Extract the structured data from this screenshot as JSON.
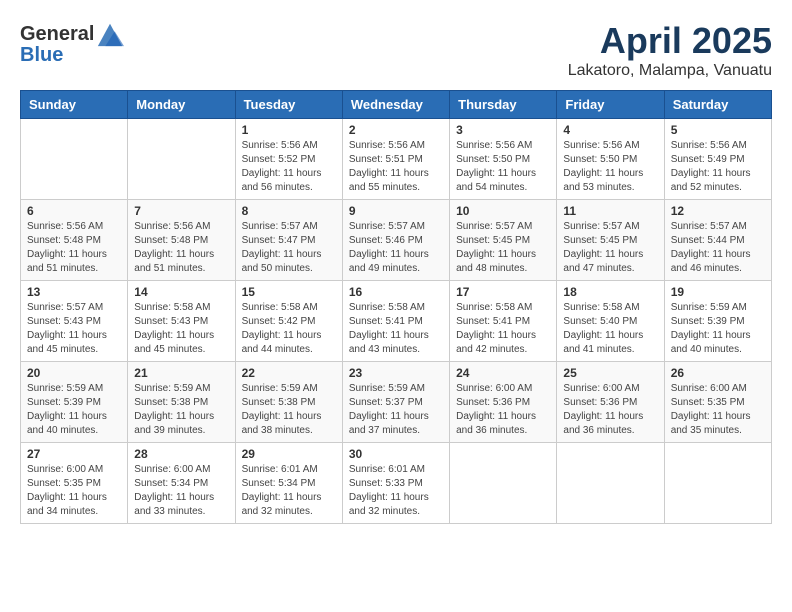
{
  "header": {
    "logo_general": "General",
    "logo_blue": "Blue",
    "month": "April 2025",
    "location": "Lakatoro, Malampa, Vanuatu"
  },
  "weekdays": [
    "Sunday",
    "Monday",
    "Tuesday",
    "Wednesday",
    "Thursday",
    "Friday",
    "Saturday"
  ],
  "weeks": [
    [
      {
        "day": "",
        "sunrise": "",
        "sunset": "",
        "daylight": ""
      },
      {
        "day": "",
        "sunrise": "",
        "sunset": "",
        "daylight": ""
      },
      {
        "day": "1",
        "sunrise": "Sunrise: 5:56 AM",
        "sunset": "Sunset: 5:52 PM",
        "daylight": "Daylight: 11 hours and 56 minutes."
      },
      {
        "day": "2",
        "sunrise": "Sunrise: 5:56 AM",
        "sunset": "Sunset: 5:51 PM",
        "daylight": "Daylight: 11 hours and 55 minutes."
      },
      {
        "day": "3",
        "sunrise": "Sunrise: 5:56 AM",
        "sunset": "Sunset: 5:50 PM",
        "daylight": "Daylight: 11 hours and 54 minutes."
      },
      {
        "day": "4",
        "sunrise": "Sunrise: 5:56 AM",
        "sunset": "Sunset: 5:50 PM",
        "daylight": "Daylight: 11 hours and 53 minutes."
      },
      {
        "day": "5",
        "sunrise": "Sunrise: 5:56 AM",
        "sunset": "Sunset: 5:49 PM",
        "daylight": "Daylight: 11 hours and 52 minutes."
      }
    ],
    [
      {
        "day": "6",
        "sunrise": "Sunrise: 5:56 AM",
        "sunset": "Sunset: 5:48 PM",
        "daylight": "Daylight: 11 hours and 51 minutes."
      },
      {
        "day": "7",
        "sunrise": "Sunrise: 5:56 AM",
        "sunset": "Sunset: 5:48 PM",
        "daylight": "Daylight: 11 hours and 51 minutes."
      },
      {
        "day": "8",
        "sunrise": "Sunrise: 5:57 AM",
        "sunset": "Sunset: 5:47 PM",
        "daylight": "Daylight: 11 hours and 50 minutes."
      },
      {
        "day": "9",
        "sunrise": "Sunrise: 5:57 AM",
        "sunset": "Sunset: 5:46 PM",
        "daylight": "Daylight: 11 hours and 49 minutes."
      },
      {
        "day": "10",
        "sunrise": "Sunrise: 5:57 AM",
        "sunset": "Sunset: 5:45 PM",
        "daylight": "Daylight: 11 hours and 48 minutes."
      },
      {
        "day": "11",
        "sunrise": "Sunrise: 5:57 AM",
        "sunset": "Sunset: 5:45 PM",
        "daylight": "Daylight: 11 hours and 47 minutes."
      },
      {
        "day": "12",
        "sunrise": "Sunrise: 5:57 AM",
        "sunset": "Sunset: 5:44 PM",
        "daylight": "Daylight: 11 hours and 46 minutes."
      }
    ],
    [
      {
        "day": "13",
        "sunrise": "Sunrise: 5:57 AM",
        "sunset": "Sunset: 5:43 PM",
        "daylight": "Daylight: 11 hours and 45 minutes."
      },
      {
        "day": "14",
        "sunrise": "Sunrise: 5:58 AM",
        "sunset": "Sunset: 5:43 PM",
        "daylight": "Daylight: 11 hours and 45 minutes."
      },
      {
        "day": "15",
        "sunrise": "Sunrise: 5:58 AM",
        "sunset": "Sunset: 5:42 PM",
        "daylight": "Daylight: 11 hours and 44 minutes."
      },
      {
        "day": "16",
        "sunrise": "Sunrise: 5:58 AM",
        "sunset": "Sunset: 5:41 PM",
        "daylight": "Daylight: 11 hours and 43 minutes."
      },
      {
        "day": "17",
        "sunrise": "Sunrise: 5:58 AM",
        "sunset": "Sunset: 5:41 PM",
        "daylight": "Daylight: 11 hours and 42 minutes."
      },
      {
        "day": "18",
        "sunrise": "Sunrise: 5:58 AM",
        "sunset": "Sunset: 5:40 PM",
        "daylight": "Daylight: 11 hours and 41 minutes."
      },
      {
        "day": "19",
        "sunrise": "Sunrise: 5:59 AM",
        "sunset": "Sunset: 5:39 PM",
        "daylight": "Daylight: 11 hours and 40 minutes."
      }
    ],
    [
      {
        "day": "20",
        "sunrise": "Sunrise: 5:59 AM",
        "sunset": "Sunset: 5:39 PM",
        "daylight": "Daylight: 11 hours and 40 minutes."
      },
      {
        "day": "21",
        "sunrise": "Sunrise: 5:59 AM",
        "sunset": "Sunset: 5:38 PM",
        "daylight": "Daylight: 11 hours and 39 minutes."
      },
      {
        "day": "22",
        "sunrise": "Sunrise: 5:59 AM",
        "sunset": "Sunset: 5:38 PM",
        "daylight": "Daylight: 11 hours and 38 minutes."
      },
      {
        "day": "23",
        "sunrise": "Sunrise: 5:59 AM",
        "sunset": "Sunset: 5:37 PM",
        "daylight": "Daylight: 11 hours and 37 minutes."
      },
      {
        "day": "24",
        "sunrise": "Sunrise: 6:00 AM",
        "sunset": "Sunset: 5:36 PM",
        "daylight": "Daylight: 11 hours and 36 minutes."
      },
      {
        "day": "25",
        "sunrise": "Sunrise: 6:00 AM",
        "sunset": "Sunset: 5:36 PM",
        "daylight": "Daylight: 11 hours and 36 minutes."
      },
      {
        "day": "26",
        "sunrise": "Sunrise: 6:00 AM",
        "sunset": "Sunset: 5:35 PM",
        "daylight": "Daylight: 11 hours and 35 minutes."
      }
    ],
    [
      {
        "day": "27",
        "sunrise": "Sunrise: 6:00 AM",
        "sunset": "Sunset: 5:35 PM",
        "daylight": "Daylight: 11 hours and 34 minutes."
      },
      {
        "day": "28",
        "sunrise": "Sunrise: 6:00 AM",
        "sunset": "Sunset: 5:34 PM",
        "daylight": "Daylight: 11 hours and 33 minutes."
      },
      {
        "day": "29",
        "sunrise": "Sunrise: 6:01 AM",
        "sunset": "Sunset: 5:34 PM",
        "daylight": "Daylight: 11 hours and 32 minutes."
      },
      {
        "day": "30",
        "sunrise": "Sunrise: 6:01 AM",
        "sunset": "Sunset: 5:33 PM",
        "daylight": "Daylight: 11 hours and 32 minutes."
      },
      {
        "day": "",
        "sunrise": "",
        "sunset": "",
        "daylight": ""
      },
      {
        "day": "",
        "sunrise": "",
        "sunset": "",
        "daylight": ""
      },
      {
        "day": "",
        "sunrise": "",
        "sunset": "",
        "daylight": ""
      }
    ]
  ]
}
